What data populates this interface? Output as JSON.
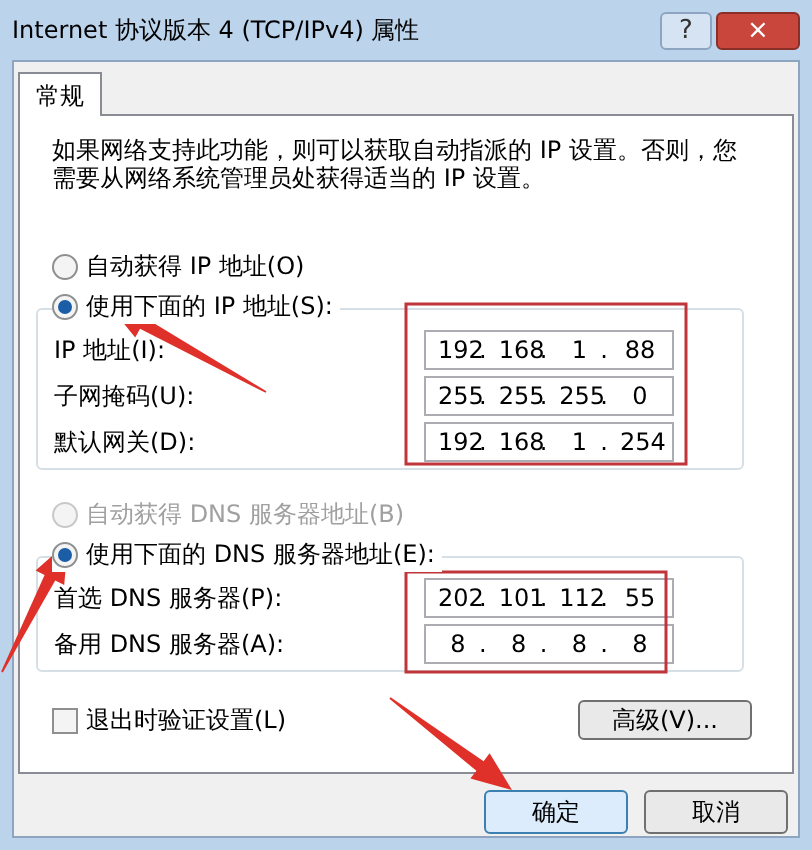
{
  "window": {
    "title": "Internet 协议版本 4 (TCP/IPv4) 属性",
    "controls": [
      {
        "kind": "help",
        "label": "?"
      },
      {
        "kind": "close",
        "label": "×"
      }
    ]
  },
  "tabs": [
    {
      "label": "常规",
      "selected": true
    }
  ],
  "description": "如果网络支持此功能，则可以获取自动指派的 IP 设置。否则，您需要从网络系统管理员处获得适当的 IP 设置。",
  "octet_separator": ".",
  "ip_section": {
    "options": [
      {
        "label": "自动获得 IP 地址(O)",
        "selected": false,
        "disabled": false
      },
      {
        "label": "使用下面的 IP 地址(S):",
        "selected": true,
        "disabled": false
      }
    ],
    "fields": [
      {
        "label": "IP 地址(I):",
        "octets": [
          "192",
          "168",
          "1",
          "88"
        ]
      },
      {
        "label": "子网掩码(U):",
        "octets": [
          "255",
          "255",
          "255",
          "0"
        ]
      },
      {
        "label": "默认网关(D):",
        "octets": [
          "192",
          "168",
          "1",
          "254"
        ]
      }
    ]
  },
  "dns_section": {
    "options": [
      {
        "label": "自动获得 DNS 服务器地址(B)",
        "selected": false,
        "disabled": true
      },
      {
        "label": "使用下面的 DNS 服务器地址(E):",
        "selected": true,
        "disabled": false
      }
    ],
    "fields": [
      {
        "label": "首选 DNS 服务器(P):",
        "octets": [
          "202",
          "101",
          "112",
          "55"
        ]
      },
      {
        "label": "备用 DNS 服务器(A):",
        "octets": [
          "8",
          "8",
          "8",
          "8"
        ]
      }
    ]
  },
  "validate_checkbox": {
    "label": "退出时验证设置(L)",
    "checked": false
  },
  "advanced_button": "高级(V)...",
  "buttons": [
    {
      "label": "确定",
      "default": true
    },
    {
      "label": "取消",
      "default": false
    }
  ],
  "annotations": [
    {
      "kind": "arrow"
    },
    {
      "kind": "arrow"
    },
    {
      "kind": "arrow"
    },
    {
      "kind": "box"
    },
    {
      "kind": "box"
    }
  ]
}
